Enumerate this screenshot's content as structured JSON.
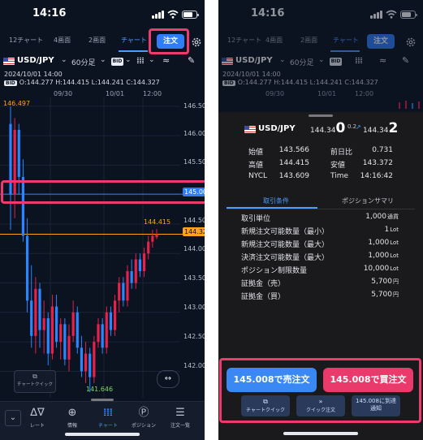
{
  "status": {
    "time": "14:16"
  },
  "tabs": [
    "12チャート",
    "4画面",
    "2画面",
    "チャート"
  ],
  "order_button": "注文",
  "toolbar": {
    "pair": "USD/JPY",
    "timeframe": "60分足",
    "bid": "BID"
  },
  "ohlc": {
    "datetime": "2024/10/01 14:00",
    "bid": "BID",
    "values": "O:144.277  H:144.415  L:144.241  C:144.327"
  },
  "chart_data": {
    "type": "candlestick",
    "x_ticks": [
      "09/30",
      "10/01",
      "12:00"
    ],
    "y_ticks": [
      "146.500",
      "146.000",
      "145.500",
      "145.008",
      "144.500",
      "144.000",
      "143.500",
      "143.000",
      "142.500",
      "142.000"
    ],
    "ylim": [
      141.55,
      146.65
    ],
    "tags": {
      "line_price": "145.008",
      "current_price": "144.327"
    },
    "annotations": {
      "high_left": "146.497",
      "recent_high": "144.415",
      "low": "141.646"
    },
    "candles": [
      [
        146.2,
        146.497,
        144.4,
        145.0
      ],
      [
        145.0,
        146.3,
        144.6,
        146.1
      ],
      [
        146.1,
        146.2,
        145.0,
        145.3
      ],
      [
        145.3,
        145.6,
        144.2,
        144.3
      ],
      [
        144.3,
        144.6,
        143.0,
        143.2
      ],
      [
        143.2,
        143.8,
        142.4,
        142.6
      ],
      [
        142.6,
        143.6,
        142.3,
        143.4
      ],
      [
        143.4,
        143.5,
        142.4,
        142.7
      ],
      [
        142.7,
        143.2,
        142.3,
        142.9
      ],
      [
        142.9,
        143.0,
        142.1,
        142.3
      ],
      [
        142.3,
        143.3,
        142.2,
        143.1
      ],
      [
        143.1,
        143.3,
        142.4,
        142.5
      ],
      [
        142.5,
        142.9,
        142.2,
        142.8
      ],
      [
        142.8,
        142.9,
        142.1,
        142.2
      ],
      [
        142.2,
        142.8,
        142.0,
        142.6
      ],
      [
        142.6,
        143.2,
        142.5,
        143.0
      ],
      [
        143.0,
        143.1,
        142.3,
        142.4
      ],
      [
        142.4,
        142.6,
        141.9,
        142.0
      ],
      [
        142.0,
        142.5,
        141.8,
        142.3
      ],
      [
        142.3,
        142.4,
        141.646,
        141.9
      ],
      [
        141.9,
        142.6,
        141.8,
        142.5
      ],
      [
        142.5,
        142.9,
        142.4,
        142.8
      ],
      [
        142.8,
        142.9,
        142.3,
        142.4
      ],
      [
        142.4,
        143.1,
        142.3,
        143.0
      ],
      [
        143.0,
        143.1,
        142.6,
        142.7
      ],
      [
        142.7,
        143.3,
        142.6,
        143.2
      ],
      [
        143.2,
        143.6,
        143.0,
        143.5
      ],
      [
        143.5,
        143.6,
        143.1,
        143.2
      ],
      [
        143.2,
        143.8,
        143.1,
        143.7
      ],
      [
        143.7,
        143.9,
        143.4,
        143.5
      ],
      [
        143.5,
        144.0,
        143.4,
        143.9
      ],
      [
        143.9,
        144.0,
        143.6,
        143.7
      ],
      [
        143.7,
        144.1,
        143.6,
        144.0
      ],
      [
        144.0,
        144.3,
        143.9,
        144.2
      ],
      [
        144.2,
        144.4,
        144.1,
        144.3
      ],
      [
        144.277,
        144.415,
        144.241,
        144.327
      ]
    ]
  },
  "quick_chart_label": "チャートクイック",
  "bottom_nav": [
    "レート",
    "情報",
    "チャート",
    "ポジション",
    "注文一覧"
  ],
  "panel": {
    "pair": "USD/JPY",
    "bid_main": "144.34",
    "bid_sup": "0",
    "spread": "0.2",
    "ask_main": "144.34",
    "ask_sup": "2",
    "quote_labels": [
      "始値",
      "高値",
      "NYCL",
      "前日比",
      "安値",
      "Time"
    ],
    "quote_values": [
      "143.566",
      "144.415",
      "143.609",
      "0.731",
      "143.372",
      "14:16:42"
    ],
    "subtabs": [
      "取引条件",
      "ポジションサマリ"
    ],
    "specs": [
      {
        "label": "取引単位",
        "value": "1,000",
        "unit": "通貨"
      },
      {
        "label": "新規注文可能数量（最小）",
        "value": "1",
        "unit": "Lot"
      },
      {
        "label": "新規注文可能数量（最大）",
        "value": "1,000",
        "unit": "Lot"
      },
      {
        "label": "決済注文可能数量（最大）",
        "value": "1,000",
        "unit": "Lot"
      },
      {
        "label": "ポジション制限数量",
        "value": "10,000",
        "unit": "Lot"
      },
      {
        "label": "証拠金（売）",
        "value": "5,700",
        "unit": "円"
      },
      {
        "label": "証拠金（買）",
        "value": "5,700",
        "unit": "円"
      }
    ],
    "sell_button": "145.008で売注文",
    "buy_button": "145.008で買注文",
    "small_buttons": [
      "チャートクイック",
      "クイック注文",
      "145.008に到達通知"
    ]
  },
  "colors": {
    "bg": "#0b1220",
    "accent": "#2f7ef6",
    "up": "#e8204a",
    "down": "#2a86ff",
    "sell": "#3a88f4",
    "buy": "#ea3a6c",
    "highlight": "#ee3a6d",
    "line": "#ffa515"
  }
}
